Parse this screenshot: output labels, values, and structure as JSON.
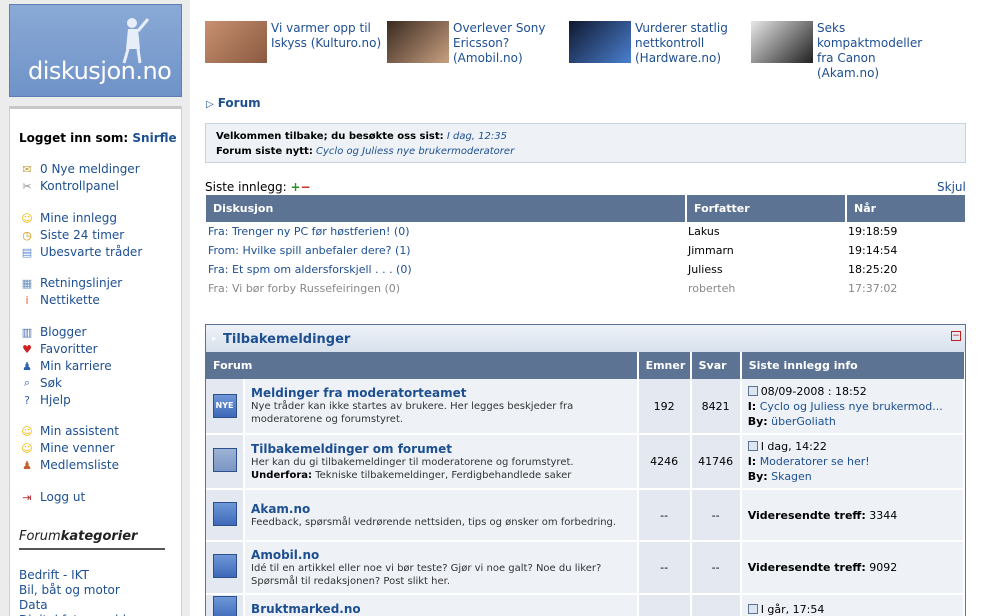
{
  "sidebar": {
    "logo_text": "diskusjon.no",
    "login_label": "Logget inn som:",
    "username": "Snirfle",
    "items": [
      {
        "label": "0 Nye meldinger",
        "icon": "envelope-icon",
        "glyph": "✉",
        "color": "#c9a040"
      },
      {
        "label": "Kontrollpanel",
        "icon": "tools-icon",
        "glyph": "✂",
        "color": "#8a8a8a"
      },
      {
        "label": "Mine innlegg",
        "icon": "smiley-icon",
        "glyph": "☺",
        "color": "#f0b400"
      },
      {
        "label": "Siste 24 timer",
        "icon": "clock-icon",
        "glyph": "◷",
        "color": "#d09000"
      },
      {
        "label": "Ubesvarte tråder",
        "icon": "folder-icon",
        "glyph": "▤",
        "color": "#5a8ad0"
      },
      {
        "label": "Retningslinjer",
        "icon": "document-icon",
        "glyph": "▦",
        "color": "#6a8fc0"
      },
      {
        "label": "Nettikette",
        "icon": "info-icon",
        "glyph": "i",
        "color": "#e06020"
      },
      {
        "label": "Blogger",
        "icon": "blog-icon",
        "glyph": "▥",
        "color": "#4a70b0"
      },
      {
        "label": "Favoritter",
        "icon": "heart-icon",
        "glyph": "♥",
        "color": "#d02020"
      },
      {
        "label": "Min karriere",
        "icon": "people-icon",
        "glyph": "♟",
        "color": "#3060b0"
      },
      {
        "label": "Søk",
        "icon": "search-icon",
        "glyph": "⌕",
        "color": "#3060b0"
      },
      {
        "label": "Hjelp",
        "icon": "help-icon",
        "glyph": "?",
        "color": "#3060b0"
      },
      {
        "label": "Min assistent",
        "icon": "assistant-icon",
        "glyph": "☺",
        "color": "#f0b400"
      },
      {
        "label": "Mine venner",
        "icon": "friends-icon",
        "glyph": "☺",
        "color": "#f0b400"
      },
      {
        "label": "Medlemsliste",
        "icon": "members-icon",
        "glyph": "♟",
        "color": "#c06030"
      },
      {
        "label": "Logg ut",
        "icon": "logout-icon",
        "glyph": "⇥",
        "color": "#b03030"
      }
    ],
    "categories_title_a": "Forum",
    "categories_title_b": "kategorier",
    "categories": [
      "Bedrift - IKT",
      "Bil, båt og motor",
      "Data",
      "Digital foto og video"
    ]
  },
  "news": [
    {
      "text": "Vi varmer opp til Iskyss (Kulturo.no)",
      "icon": "kiss-photo-thumbnail",
      "colors": [
        "#c89070",
        "#8a5a40"
      ]
    },
    {
      "text": "Overlever Sony Ericsson? (Amobil.no)",
      "icon": "sony-ericsson-photo-thumbnail",
      "colors": [
        "#3a2a20",
        "#c8a080"
      ]
    },
    {
      "text": "Vurderer statlig nettkontroll (Hardware.no)",
      "icon": "network-control-thumbnail",
      "colors": [
        "#101830",
        "#4a80d0"
      ]
    },
    {
      "text": "Seks kompaktmodeller fra Canon (Akam.no)",
      "icon": "canon-camera-thumbnail",
      "colors": [
        "#e8e8e8",
        "#202020"
      ]
    }
  ],
  "breadcrumb": "Forum",
  "welcome": {
    "line1_label": "Velkommen tilbake; du besøkte oss sist:",
    "line1_value": "I dag, 12:35",
    "line2_label": "Forum siste nytt:",
    "line2_value": "Cyclo og Juliess nye brukermoderatorer"
  },
  "latest": {
    "label": "Siste innlegg:",
    "hide": "Skjul",
    "columns": [
      "Diskusjon",
      "Forfatter",
      "Når"
    ],
    "rows": [
      {
        "topic": "Fra: Trenger ny PC før høstferien! (0)",
        "author": "Lakus",
        "time": "19:18:59",
        "faded": false
      },
      {
        "topic": "From: Hvilke spill anbefaler dere? (1)",
        "author": "Jimmarn",
        "time": "19:14:54",
        "faded": false
      },
      {
        "topic": "Fra: Et spm om aldersforskjell . . . (0)",
        "author": "Juliess",
        "time": "18:25:20",
        "faded": false
      },
      {
        "topic": "Fra: Vi bør forby Russefeiringen (0)",
        "author": "roberteh",
        "time": "17:37:02",
        "faded": true
      }
    ]
  },
  "feedback": {
    "title": "Tilbakemeldinger",
    "columns": [
      "Forum",
      "Emner",
      "Svar",
      "Siste innlegg info"
    ],
    "forums": [
      {
        "icon_label": "NYE",
        "old": false,
        "title": "Meldinger fra moderatorteamet",
        "desc": "Nye tråder kan ikke startes av brukere. Her legges beskjeder fra moderatorene og forumstyret.",
        "sub_label": "",
        "sub_value": "",
        "topics": "192",
        "replies": "8421",
        "last_date": "08/09-2008 : 18:52",
        "last_in_label": "I:",
        "last_in": "Cyclo og Juliess nye brukermod...",
        "last_by_label": "By:",
        "last_by": "überGoliath",
        "fwd_label": "",
        "fwd_value": ""
      },
      {
        "icon_label": "",
        "old": true,
        "title": "Tilbakemeldinger om forumet",
        "desc": "Her kan du gi tilbakemeldinger til moderatorene og forumstyret.",
        "sub_label": "Underfora:",
        "sub_value": "Tekniske tilbakemeldinger, Ferdigbehandlede saker",
        "topics": "4246",
        "replies": "41746",
        "last_date": "I dag, 14:22",
        "last_in_label": "I:",
        "last_in": "Moderatorer se her!",
        "last_by_label": "By:",
        "last_by": "Skagen",
        "fwd_label": "",
        "fwd_value": ""
      },
      {
        "icon_label": "",
        "old": false,
        "title": "Akam.no",
        "desc": "Feedback, spørsmål vedrørende nettsiden, tips og ønsker om forbedring.",
        "sub_label": "",
        "sub_value": "",
        "topics": "--",
        "replies": "--",
        "last_date": "",
        "last_in_label": "",
        "last_in": "",
        "last_by_label": "",
        "last_by": "",
        "fwd_label": "Videresendte treff:",
        "fwd_value": "3344"
      },
      {
        "icon_label": "",
        "old": false,
        "title": "Amobil.no",
        "desc": "Idé til en artikkel eller noe vi bør teste? Gjør vi noe galt? Noe du liker? Spørsmål til redaksjonen? Post slikt her.",
        "sub_label": "",
        "sub_value": "",
        "topics": "--",
        "replies": "--",
        "last_date": "",
        "last_in_label": "",
        "last_in": "",
        "last_by_label": "",
        "last_by": "",
        "fwd_label": "Videresendte treff:",
        "fwd_value": "9092"
      },
      {
        "icon_label": "",
        "old": false,
        "title": "Bruktmarked.no",
        "desc": "",
        "sub_label": "",
        "sub_value": "",
        "topics": "",
        "replies": "",
        "last_date": "I går, 17:54",
        "last_in_label": "",
        "last_in": "",
        "last_by_label": "",
        "last_by": "",
        "fwd_label": "",
        "fwd_value": ""
      }
    ]
  }
}
